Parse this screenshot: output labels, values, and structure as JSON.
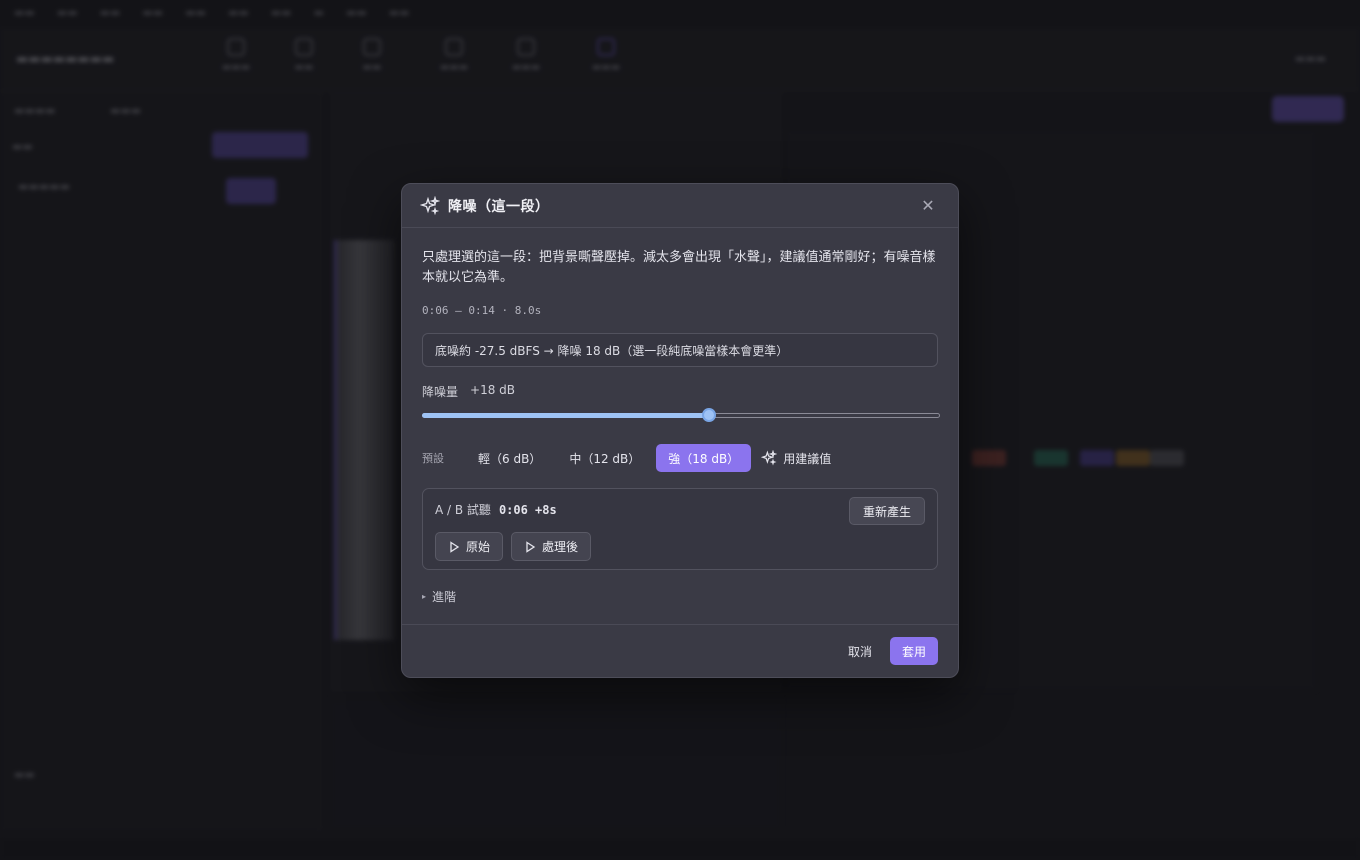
{
  "dialog": {
    "title": "降噪（這一段）",
    "description": "只處理選的這一段：把背景嘶聲壓掉。減太多會出現「水聲」，建議值通常剛好；有噪音樣本就以它為準。",
    "range_info": "0:06 – 0:14 · 8.0s",
    "noise_info": "底噪約 -27.5 dBFS → 降噪 18 dB（選一段純底噪當樣本會更準）",
    "amount_label": "降噪量",
    "amount_value": "+18 dB",
    "amount_fraction": 0.555,
    "preset_label": "預設",
    "presets": [
      {
        "label": "輕（6 dB）",
        "active": false
      },
      {
        "label": "中（12 dB）",
        "active": false
      },
      {
        "label": "強（18 dB）",
        "active": true
      }
    ],
    "suggest_label": "用建議值",
    "ab": {
      "title": "A / B 試聽",
      "position": "0:06 +8s",
      "regenerate_label": "重新產生",
      "original_label": "原始",
      "processed_label": "處理後"
    },
    "advanced_label": "進階",
    "cancel_label": "取消",
    "apply_label": "套用"
  },
  "colors": {
    "accent": "#8b74ee",
    "slider": "#9ec3f5",
    "dialog_bg": "#3a3a45"
  }
}
